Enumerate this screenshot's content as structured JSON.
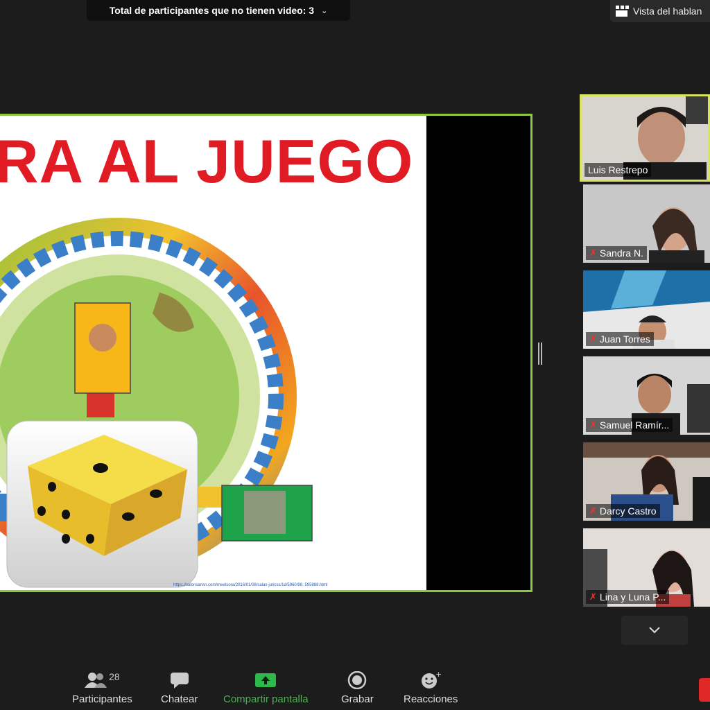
{
  "top_bar": {
    "no_video_label": "Total de participantes que no tienen video: 3",
    "view_label": "Vista del hablan"
  },
  "slide": {
    "title": "RA AL JUEGO",
    "url": "https://salonsansn.com/meetsora/2016/01/08/salas-juricss/1d/5960/98. 595888.html"
  },
  "participants": [
    {
      "name": "Luis Restrepo",
      "muted": false,
      "active": true
    },
    {
      "name": "Sandra N.",
      "muted": true
    },
    {
      "name": "Juan Torres",
      "muted": true
    },
    {
      "name": "Samuel Ramír...",
      "muted": true
    },
    {
      "name": "Darcy Castro",
      "muted": true
    },
    {
      "name": "Lina y Luna P...",
      "muted": true
    }
  ],
  "toolbar": {
    "participants_label": "Participantes",
    "participants_count": "28",
    "chat_label": "Chatear",
    "share_label": "Compartir pantalla",
    "record_label": "Grabar",
    "reactions_label": "Reacciones"
  },
  "colors": {
    "accent_border": "#8dc63f",
    "active_speaker": "#d8e45a",
    "share_green": "#4caf50",
    "title_red": "#e01b24"
  }
}
